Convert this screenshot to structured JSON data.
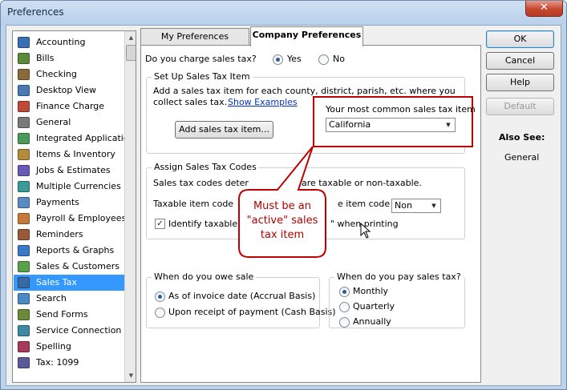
{
  "window": {
    "title": "Preferences",
    "close_glyph": "✕"
  },
  "sidebar": {
    "items": [
      {
        "label": "Accounting",
        "icon": "accounting-icon",
        "color": "#3a6fb5"
      },
      {
        "label": "Bills",
        "icon": "bills-icon",
        "color": "#5c8a3a"
      },
      {
        "label": "Checking",
        "icon": "checking-icon",
        "color": "#8a6a3a"
      },
      {
        "label": "Desktop View",
        "icon": "desktop-view-icon",
        "color": "#4a7ab5"
      },
      {
        "label": "Finance Charge",
        "icon": "finance-charge-icon",
        "color": "#c04a3a"
      },
      {
        "label": "General",
        "icon": "general-icon",
        "color": "#7a7a7a"
      },
      {
        "label": "Integrated Applicatio",
        "icon": "integrated-applications-icon",
        "color": "#4a9a5a"
      },
      {
        "label": "Items & Inventory",
        "icon": "items-inventory-icon",
        "color": "#b58a3a"
      },
      {
        "label": "Jobs & Estimates",
        "icon": "jobs-estimates-icon",
        "color": "#6a5ab5"
      },
      {
        "label": "Multiple Currencies",
        "icon": "multiple-currencies-icon",
        "color": "#3a9a9a"
      },
      {
        "label": "Payments",
        "icon": "payments-icon",
        "color": "#5a8ac5"
      },
      {
        "label": "Payroll & Employees",
        "icon": "payroll-employees-icon",
        "color": "#c57a3a"
      },
      {
        "label": "Reminders",
        "icon": "reminders-icon",
        "color": "#9a5a3a"
      },
      {
        "label": "Reports & Graphs",
        "icon": "reports-graphs-icon",
        "color": "#3a7ac5"
      },
      {
        "label": "Sales & Customers",
        "icon": "sales-customers-icon",
        "color": "#5aa04a"
      },
      {
        "label": "Sales Tax",
        "icon": "sales-tax-icon",
        "color": "#3a6aa5",
        "selected": true
      },
      {
        "label": "Search",
        "icon": "search-icon",
        "color": "#4a8ac5"
      },
      {
        "label": "Send Forms",
        "icon": "send-forms-icon",
        "color": "#6a8a3a"
      },
      {
        "label": "Service Connection",
        "icon": "service-connection-icon",
        "color": "#3a8aa5"
      },
      {
        "label": "Spelling",
        "icon": "spelling-icon",
        "color": "#a53a5a"
      },
      {
        "label": "Tax: 1099",
        "icon": "tax-1099-icon",
        "color": "#5a5a9a"
      }
    ]
  },
  "tabs": {
    "my": "My Preferences",
    "company": "Company Preferences"
  },
  "charge": {
    "question": "Do you charge sales tax?",
    "yes": "Yes",
    "no": "No",
    "selected": "Yes"
  },
  "setup": {
    "title": "Set Up Sales Tax Item",
    "desc_line1": "Add a sales tax item for each county, district, parish, etc. where you",
    "desc_line2": "collect sales tax.",
    "show_examples": "Show Examples",
    "add_button": "Add sales tax item...",
    "common_label": "Your most common sales tax item",
    "common_value": "California"
  },
  "assign": {
    "title": "Assign Sales Tax Codes",
    "desc_left": "Sales tax codes deter",
    "desc_right": "are taxable or non-taxable.",
    "taxable_label": "Taxable item code",
    "nontax_label_partial": "e item code",
    "nontax_value": "Non",
    "identify_left": "Identify taxable a",
    "identify_right": "\" when printing",
    "identify_checked": true
  },
  "callout": {
    "line1": "Must be an",
    "line2": "\"active\" sales",
    "line3": "tax item"
  },
  "owe": {
    "title": "When do you owe sale",
    "option1": "As of invoice date (Accrual Basis)",
    "option2": "Upon receipt of payment (Cash Basis)",
    "selected": "As of invoice date (Accrual Basis)"
  },
  "pay": {
    "title": "When do you pay sales tax?",
    "option1": "Monthly",
    "option2": "Quarterly",
    "option3": "Annually",
    "selected": "Monthly"
  },
  "buttons": {
    "ok": "OK",
    "cancel": "Cancel",
    "help": "Help",
    "default": "Default"
  },
  "also_see": {
    "heading": "Also See:",
    "link": "General"
  }
}
